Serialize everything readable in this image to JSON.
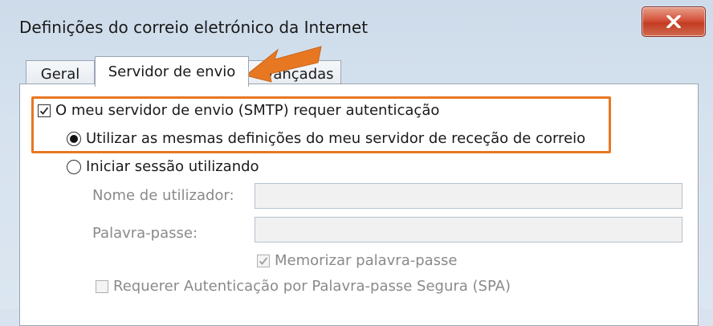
{
  "window": {
    "title": "Definições do correio eletrónico da Internet",
    "close_icon": "close-icon"
  },
  "tabs": [
    {
      "label": "Geral",
      "active": false
    },
    {
      "label": "Servidor de envio",
      "active": true
    },
    {
      "label": "Avançadas",
      "active": false
    }
  ],
  "smtp_auth": {
    "label": "O meu servidor de envio (SMTP) requer autenticação",
    "checked": true
  },
  "radio_same": {
    "label": "Utilizar as mesmas definições do meu servidor de receção de correio",
    "selected": true
  },
  "radio_login": {
    "label": "Iniciar sessão utilizando",
    "selected": false
  },
  "username": {
    "label": "Nome de utilizador:",
    "value": ""
  },
  "password": {
    "label": "Palavra-passe:",
    "value": ""
  },
  "remember": {
    "label": "Memorizar palavra-passe",
    "checked": true,
    "enabled": false
  },
  "spa": {
    "label": "Requerer Autenticação por Palavra-passe Segura (SPA)",
    "checked": false,
    "enabled": false
  },
  "colors": {
    "highlight": "#e87722",
    "close": "#c23c22"
  }
}
